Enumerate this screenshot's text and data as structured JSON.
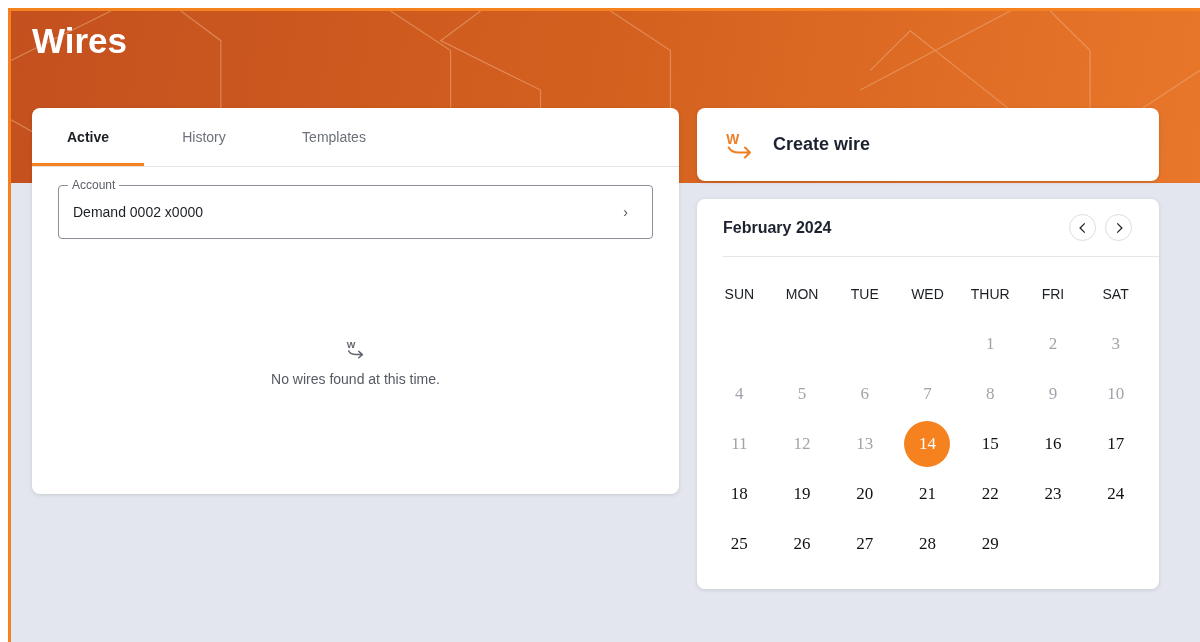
{
  "page": {
    "title": "Wires"
  },
  "tabs": [
    {
      "label": "Active",
      "selected": true
    },
    {
      "label": "History",
      "selected": false
    },
    {
      "label": "Templates",
      "selected": false
    }
  ],
  "account": {
    "label": "Account",
    "value": "Demand 0002 x0000",
    "chevron": "›"
  },
  "empty_state": {
    "icon_letter": "W",
    "message": "No wires found at this time."
  },
  "create_wire": {
    "icon_letter": "W",
    "label": "Create wire"
  },
  "calendar": {
    "month": "February 2024",
    "weekdays": [
      "SUN",
      "MON",
      "TUE",
      "WED",
      "THUR",
      "FRI",
      "SAT"
    ],
    "weeks": [
      {
        "starts_mid_week": true,
        "days": [
          {
            "day": "1",
            "disabled": true,
            "selected": false
          },
          {
            "day": "2",
            "disabled": true,
            "selected": false
          },
          {
            "day": "3",
            "disabled": true,
            "selected": false
          }
        ]
      },
      {
        "days": [
          {
            "day": "4",
            "disabled": true,
            "selected": false
          },
          {
            "day": "5",
            "disabled": true,
            "selected": false
          },
          {
            "day": "6",
            "disabled": true,
            "selected": false
          },
          {
            "day": "7",
            "disabled": true,
            "selected": false
          },
          {
            "day": "8",
            "disabled": true,
            "selected": false
          },
          {
            "day": "9",
            "disabled": true,
            "selected": false
          },
          {
            "day": "10",
            "disabled": true,
            "selected": false
          }
        ]
      },
      {
        "days": [
          {
            "day": "11",
            "disabled": true,
            "selected": false
          },
          {
            "day": "12",
            "disabled": true,
            "selected": false
          },
          {
            "day": "13",
            "disabled": true,
            "selected": false
          },
          {
            "day": "14",
            "disabled": false,
            "selected": true
          },
          {
            "day": "15",
            "disabled": false,
            "selected": false
          },
          {
            "day": "16",
            "disabled": false,
            "selected": false
          },
          {
            "day": "17",
            "disabled": false,
            "selected": false
          }
        ]
      },
      {
        "days": [
          {
            "day": "18",
            "disabled": false,
            "selected": false
          },
          {
            "day": "19",
            "disabled": false,
            "selected": false
          },
          {
            "day": "20",
            "disabled": false,
            "selected": false
          },
          {
            "day": "21",
            "disabled": false,
            "selected": false
          },
          {
            "day": "22",
            "disabled": false,
            "selected": false
          },
          {
            "day": "23",
            "disabled": false,
            "selected": false
          },
          {
            "day": "24",
            "disabled": false,
            "selected": false
          }
        ]
      },
      {
        "starts_mid_week": false,
        "days": [
          {
            "day": "25",
            "disabled": false,
            "selected": false
          },
          {
            "day": "26",
            "disabled": false,
            "selected": false
          },
          {
            "day": "27",
            "disabled": false,
            "selected": false
          },
          {
            "day": "28",
            "disabled": false,
            "selected": false
          },
          {
            "day": "29",
            "disabled": false,
            "selected": false
          }
        ]
      }
    ]
  }
}
